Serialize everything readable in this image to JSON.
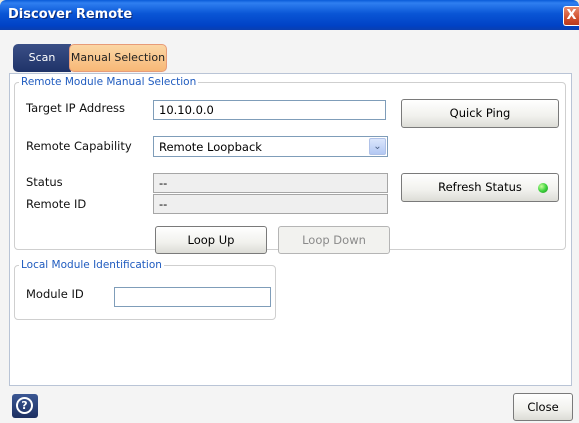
{
  "window": {
    "title": "Discover Remote",
    "close_glyph": "X"
  },
  "tabs": {
    "scan": "Scan",
    "manual": "Manual Selection",
    "active": "manual"
  },
  "remote_group": {
    "legend": "Remote Module Manual Selection",
    "target_ip_label": "Target IP Address",
    "target_ip_value": "10.10.0.0",
    "quick_ping_label": "Quick Ping",
    "capability_label": "Remote Capability",
    "capability_value": "Remote Loopback",
    "status_label": "Status",
    "status_value": "--",
    "remote_id_label": "Remote ID",
    "remote_id_value": "--",
    "refresh_label": "Refresh Status",
    "status_led_color": "#3ed33e",
    "loop_up_label": "Loop Up",
    "loop_down_label": "Loop Down"
  },
  "local_group": {
    "legend": "Local Module Identification",
    "module_id_label": "Module ID",
    "module_id_value": ""
  },
  "footer": {
    "help_icon": "?",
    "close_label": "Close"
  },
  "colors": {
    "titlebar": "#0a56d6",
    "active_tab": "#f7b877",
    "legend_text": "#1f5bbf"
  }
}
